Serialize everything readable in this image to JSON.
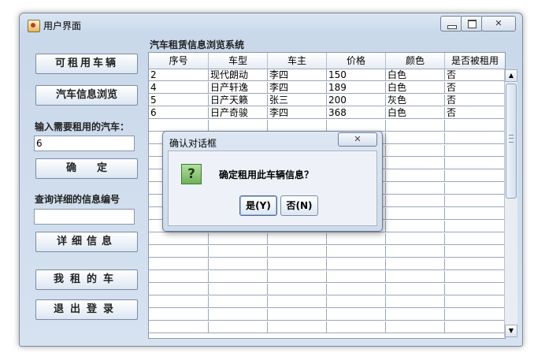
{
  "window": {
    "title": "用户界面"
  },
  "left_panel": {
    "rentable_button": "可租用车辆",
    "browse_button": "汽车信息浏览",
    "input_car_label": "输入需要租用的汽车：",
    "input_car_value": "6",
    "confirm_button": "确　　定",
    "query_label": "查询详细的信息编号",
    "query_value": "",
    "detail_button": "详细信息",
    "my_cars_button": "我租的车",
    "logout_button": "退出登录"
  },
  "table": {
    "title": "汽车租赁信息浏览系统",
    "headers": [
      "序号",
      "车型",
      "车主",
      "价格",
      "颜色",
      "是否被租用"
    ],
    "rows": [
      [
        "2",
        "现代朗动",
        "李四",
        "150",
        "白色",
        "否"
      ],
      [
        "4",
        "日产轩逸",
        "李四",
        "189",
        "白色",
        "否"
      ],
      [
        "5",
        "日产天籁",
        "张三",
        "200",
        "灰色",
        "否"
      ],
      [
        "6",
        "日产奇骏",
        "李四",
        "368",
        "白色",
        "否"
      ]
    ]
  },
  "dialog": {
    "title": "确认对话框",
    "message": "确定租用此车辆信息？",
    "yes_button": "是(Y)",
    "no_button": "否(N)"
  },
  "icons": {
    "app": "java-app-icon",
    "question": "question-icon"
  }
}
